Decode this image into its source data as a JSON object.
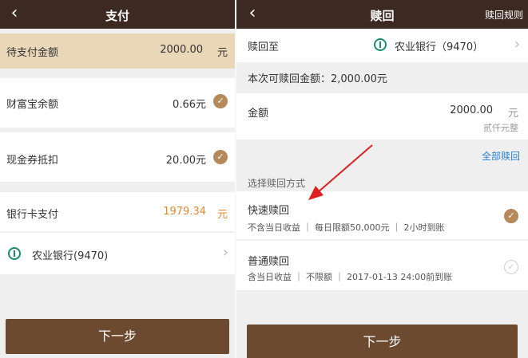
{
  "left": {
    "header": {
      "back_icon": "chevron-left-icon",
      "title": "支付"
    },
    "pending": {
      "label": "待支付金额",
      "amount": "2000.00",
      "unit": "元"
    },
    "balance": {
      "label": "财富宝余额",
      "value": "0.66元"
    },
    "coupon": {
      "label": "现金券抵扣",
      "value": "20.00元"
    },
    "card_pay": {
      "label": "银行卡支付",
      "amount": "1979.34",
      "unit": "元"
    },
    "bank": {
      "name": "农业银行(9470)"
    },
    "next_button": "下一步"
  },
  "right": {
    "header": {
      "back_icon": "chevron-left-icon",
      "title": "赎回",
      "rules": "赎回规则"
    },
    "redeem_to": {
      "label": "赎回至",
      "bank": "农业银行（9470）"
    },
    "available": "本次可赎回金额：2,000.00元",
    "amount": {
      "label": "金额",
      "value": "2000.00",
      "unit": "元",
      "chinese": "贰仟元整"
    },
    "redeem_all": "全部赎回",
    "method_title": "选择赎回方式",
    "methods": [
      {
        "title": "快速赎回",
        "desc": "不含当日收益 ｜ 每日限额50,000元 ｜ 2小时到账",
        "selected": true
      },
      {
        "title": "普通赎回",
        "desc": "含当日收益 ｜ 不限额 ｜ 2017-01-13 24:00前到账",
        "selected": false
      }
    ],
    "next_button": "下一步"
  },
  "colors": {
    "header": "#3c2a22",
    "button": "#6b4a2f",
    "accent_orange": "#e8872a",
    "check": "#b5895a",
    "highlight": "#e9d7b8",
    "link_blue": "#2a7fd4",
    "arrow_red": "#e02020"
  }
}
